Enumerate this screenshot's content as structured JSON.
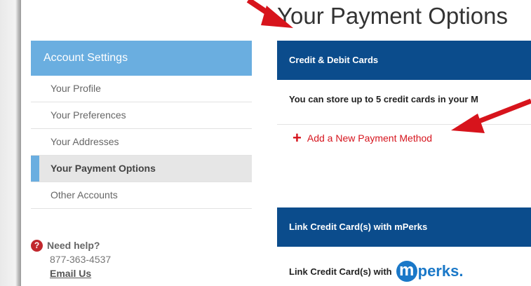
{
  "page": {
    "title": "Your Payment Options"
  },
  "sidebar": {
    "header": "Account Settings",
    "items": [
      {
        "label": "Your Profile"
      },
      {
        "label": "Your Preferences"
      },
      {
        "label": "Your Addresses"
      },
      {
        "label": "Your Payment Options",
        "active": true
      },
      {
        "label": "Other Accounts"
      }
    ]
  },
  "help": {
    "icon": "question-icon",
    "title": "Need help?",
    "phone": "877-363-4537",
    "email_link": "Email Us"
  },
  "cards": {
    "section_title": "Credit & Debit Cards",
    "store_text": "You can store up to 5 credit cards in your M",
    "add_link": "Add a New Payment Method"
  },
  "mperks": {
    "section_title": "Link Credit Card(s) with mPerks",
    "link_text": "Link Credit Card(s) with",
    "logo_letter": "m",
    "logo_text": "perks."
  },
  "colors": {
    "sidebar_accent": "#6aaee0",
    "section_bar": "#0b4c8c",
    "link_red": "#d6141d",
    "annotation_red": "#d7141c",
    "mperks_blue": "#1a78c8"
  }
}
